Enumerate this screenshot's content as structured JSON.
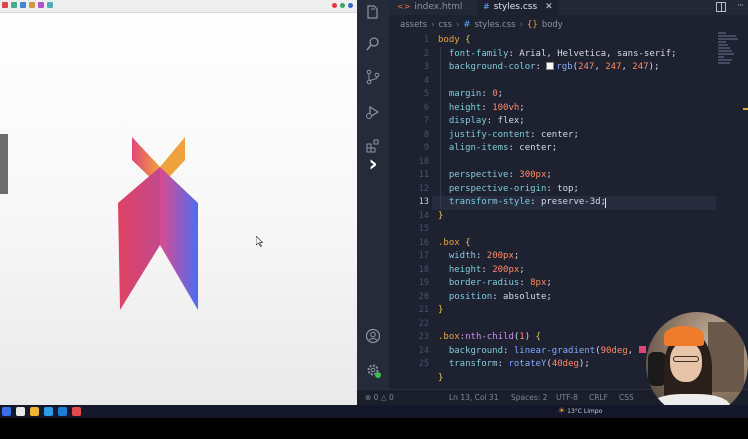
{
  "editor": {
    "tabs": [
      {
        "label": "index.html",
        "icon": "html-file-icon"
      },
      {
        "label": "styles.css",
        "icon": "css-file-icon",
        "active": true
      }
    ],
    "breadcrumb": [
      "assets",
      "css",
      "styles.css",
      "body"
    ],
    "active_line": 13,
    "line_numbers": [
      "1",
      "2",
      "3",
      "4",
      "5",
      "6",
      "7",
      "8",
      "9",
      "10",
      "11",
      "12",
      "13",
      "14",
      "15",
      "16",
      "17",
      "18",
      "19",
      "20",
      "21",
      "22",
      "23",
      "24",
      "25"
    ],
    "lines": [
      [
        {
          "t": "body",
          "c": "sel"
        },
        {
          "t": " {",
          "c": "br"
        }
      ],
      [
        {
          "t": "  font-family",
          "c": "prop"
        },
        {
          "t": ": Arial, Helvetica, sans-serif;",
          "c": "val"
        }
      ],
      [
        {
          "t": "  background-color",
          "c": "prop"
        },
        {
          "t": ": ",
          "c": "val"
        },
        {
          "t": "__swatch__",
          "c": "swatch"
        },
        {
          "t": "rgb",
          "c": "fn"
        },
        {
          "t": "(",
          "c": "val"
        },
        {
          "t": "247",
          "c": "num"
        },
        {
          "t": ", ",
          "c": "val"
        },
        {
          "t": "247",
          "c": "num"
        },
        {
          "t": ", ",
          "c": "val"
        },
        {
          "t": "247",
          "c": "num"
        },
        {
          "t": ");",
          "c": "val"
        }
      ],
      [],
      [
        {
          "t": "  margin",
          "c": "prop"
        },
        {
          "t": ": ",
          "c": "val"
        },
        {
          "t": "0",
          "c": "num"
        },
        {
          "t": ";",
          "c": "val"
        }
      ],
      [
        {
          "t": "  height",
          "c": "prop"
        },
        {
          "t": ": ",
          "c": "val"
        },
        {
          "t": "100vh",
          "c": "num"
        },
        {
          "t": ";",
          "c": "val"
        }
      ],
      [
        {
          "t": "  display",
          "c": "prop"
        },
        {
          "t": ": flex;",
          "c": "val"
        }
      ],
      [
        {
          "t": "  justify-content",
          "c": "prop"
        },
        {
          "t": ": center;",
          "c": "val"
        }
      ],
      [
        {
          "t": "  align-items",
          "c": "prop"
        },
        {
          "t": ": center;",
          "c": "val"
        }
      ],
      [],
      [
        {
          "t": "  perspective",
          "c": "prop"
        },
        {
          "t": ": ",
          "c": "val"
        },
        {
          "t": "300px",
          "c": "num"
        },
        {
          "t": ";",
          "c": "val"
        }
      ],
      [
        {
          "t": "  perspective-origin",
          "c": "prop"
        },
        {
          "t": ": top;",
          "c": "val"
        }
      ],
      [
        {
          "t": "  transform-style",
          "c": "prop"
        },
        {
          "t": ": preserve-3d;",
          "c": "val"
        }
      ],
      [
        {
          "t": "}",
          "c": "br"
        }
      ],
      [],
      [
        {
          "t": ".box",
          "c": "sel"
        },
        {
          "t": " {",
          "c": "br"
        }
      ],
      [
        {
          "t": "  width",
          "c": "prop"
        },
        {
          "t": ": ",
          "c": "val"
        },
        {
          "t": "200px",
          "c": "num"
        },
        {
          "t": ";",
          "c": "val"
        }
      ],
      [
        {
          "t": "  height",
          "c": "prop"
        },
        {
          "t": ": ",
          "c": "val"
        },
        {
          "t": "200px",
          "c": "num"
        },
        {
          "t": ";",
          "c": "val"
        }
      ],
      [
        {
          "t": "  border-radius",
          "c": "prop"
        },
        {
          "t": ": ",
          "c": "val"
        },
        {
          "t": "8px",
          "c": "num"
        },
        {
          "t": ";",
          "c": "val"
        }
      ],
      [
        {
          "t": "  position",
          "c": "prop"
        },
        {
          "t": ": absolute;",
          "c": "val"
        }
      ],
      [
        {
          "t": "}",
          "c": "br"
        }
      ],
      [],
      [
        {
          "t": ".box",
          "c": "sel"
        },
        {
          "t": ":nth-child",
          "c": "pseudo"
        },
        {
          "t": "(",
          "c": "val"
        },
        {
          "t": "1",
          "c": "num"
        },
        {
          "t": ")",
          "c": "val"
        },
        {
          "t": " {",
          "c": "br"
        }
      ],
      [
        {
          "t": "  background",
          "c": "prop"
        },
        {
          "t": ": ",
          "c": "val"
        },
        {
          "t": "linear-gradient",
          "c": "fn"
        },
        {
          "t": "(",
          "c": "val"
        },
        {
          "t": "90deg",
          "c": "num"
        },
        {
          "t": ", ",
          "c": "val"
        },
        {
          "t": "__swatch2__",
          "c": "swatch2"
        }
      ],
      [
        {
          "t": "  transform",
          "c": "prop"
        },
        {
          "t": ": ",
          "c": "val"
        },
        {
          "t": "rotateY",
          "c": "fn"
        },
        {
          "t": "(",
          "c": "val"
        },
        {
          "t": "40deg",
          "c": "num"
        },
        {
          "t": ");",
          "c": "val"
        }
      ],
      [
        {
          "t": "}",
          "c": "br"
        }
      ]
    ],
    "status": {
      "errors": "0",
      "warnings": "0",
      "position": "Ln 13, Col 31",
      "spaces": "Spaces: 2",
      "encoding": "UTF-8",
      "eol": "CRLF",
      "language": "CSS"
    },
    "activity_icons": [
      "files-icon",
      "search-icon",
      "source-control-icon",
      "run-debug-icon",
      "extensions-icon",
      "account-icon",
      "settings-icon"
    ]
  },
  "taskbar": {
    "weather": "13°C Limpo"
  },
  "colors": {
    "gradient_pink": "#e0467a",
    "gradient_orange": "#f2a23a",
    "gradient_blue": "#4f6cf0",
    "editor_bg": "#1e2230"
  }
}
